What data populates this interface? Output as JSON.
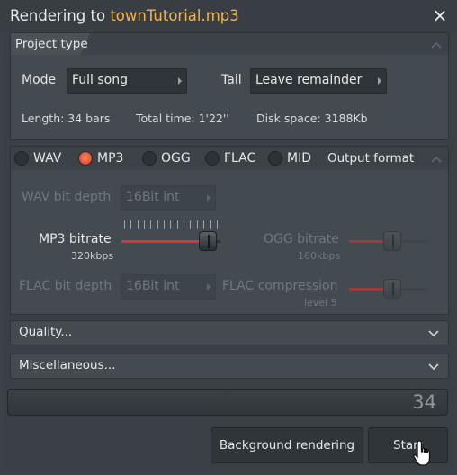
{
  "window": {
    "title_prefix": "Rendering to ",
    "title_file": "townTutorial.mp3",
    "close_glyph": "×"
  },
  "project_type": {
    "header": "Project type",
    "mode_label": "Mode",
    "mode_value": "Full song",
    "tail_label": "Tail",
    "tail_value": "Leave remainder",
    "length": "Length: 34 bars",
    "total_time": "Total time: 1'22''",
    "disk_space": "Disk space: 3188Kb"
  },
  "output_format": {
    "header": "Output format",
    "formats": [
      {
        "label": "WAV",
        "selected": false
      },
      {
        "label": "MP3",
        "selected": true
      },
      {
        "label": "OGG",
        "selected": false
      },
      {
        "label": "FLAC",
        "selected": false
      },
      {
        "label": "MID",
        "selected": false
      }
    ],
    "wav_bit_depth_label": "WAV bit depth",
    "wav_bit_depth_value": "16Bit int",
    "mp3_bitrate_label": "MP3 bitrate",
    "mp3_bitrate_value": "320kbps",
    "mp3_bitrate_level": 1.0,
    "ogg_bitrate_label": "OGG bitrate",
    "ogg_bitrate_value": "160kbps",
    "ogg_bitrate_level": 0.55,
    "flac_bit_depth_label": "FLAC bit depth",
    "flac_bit_depth_value": "16Bit int",
    "flac_compression_label": "FLAC compression",
    "flac_compression_value": "level 5",
    "flac_compression_level": 0.55
  },
  "sections": {
    "quality": "Quality...",
    "misc": "Miscellaneous..."
  },
  "progress": {
    "value_text": "34",
    "fraction": 1.0
  },
  "buttons": {
    "background_rendering": "Background rendering",
    "start": "Start"
  },
  "colors": {
    "title_file": "#f0b54a",
    "slider_fill": "#d23a3a",
    "radio_on": "#e85a3c"
  },
  "icons": {
    "close": "close-icon",
    "collapse_up": "chevron-up-icon",
    "expand_down": "chevron-down-icon",
    "dropdown": "caret-right-icon",
    "cursor": "hand-cursor-icon"
  }
}
